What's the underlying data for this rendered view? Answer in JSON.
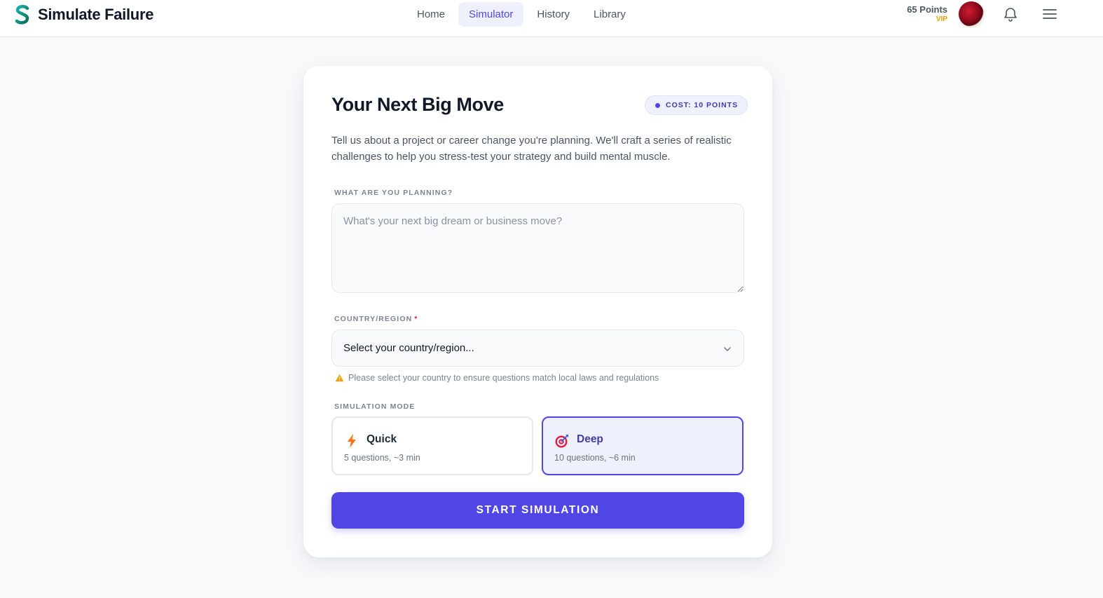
{
  "header": {
    "brand_name": "Simulate Failure",
    "nav": [
      {
        "label": "Home",
        "active": false
      },
      {
        "label": "Simulator",
        "active": true
      },
      {
        "label": "History",
        "active": false
      },
      {
        "label": "Library",
        "active": false
      }
    ],
    "points": "65 Points",
    "tier": "VIP",
    "icons": {
      "bell": "bell-icon",
      "menu": "hamburger-menu-icon",
      "logo": "s-logo-icon"
    }
  },
  "card": {
    "title": "Your Next Big Move",
    "cost_badge": "COST: 10 POINTS",
    "intro": "Tell us about a project or career change you're planning. We'll craft a series of realistic challenges to help you stress-test your strategy and build mental muscle.",
    "planning": {
      "label": "WHAT ARE YOU PLANNING?",
      "value": "",
      "placeholder": "What's your next big dream or business move?"
    },
    "country": {
      "label": "COUNTRY/REGION",
      "required_mark": "*",
      "selected": "Select your country/region...",
      "hint": "Please select your country to ensure questions match local laws and regulations"
    },
    "mode": {
      "label": "SIMULATION MODE",
      "options": [
        {
          "title": "Quick",
          "subtitle": "5 questions, ~3 min",
          "icon": "lightning-icon",
          "selected": false
        },
        {
          "title": "Deep",
          "subtitle": "10 questions, ~6 min",
          "icon": "target-icon",
          "selected": true
        }
      ]
    },
    "submit_label": "START SIMULATION"
  },
  "colors": {
    "accent": "#4f46e5",
    "accent_light": "#eef0fc",
    "tier": "#e0a100",
    "background": "#f8f9fb"
  }
}
